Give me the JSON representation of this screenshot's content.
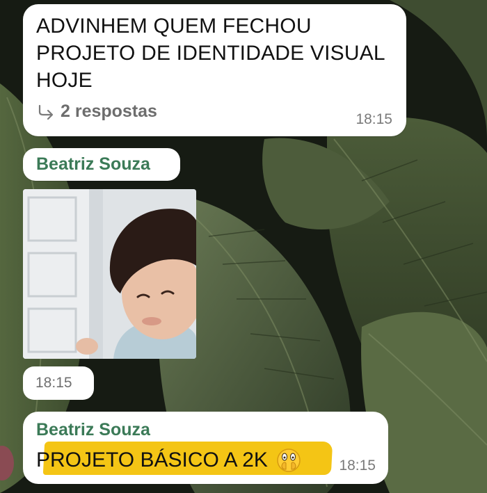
{
  "chat": {
    "message1": {
      "text": "ADVINHEM QUEM FECHOU PROJETO DE IDENTIDADE VISUAL HOJE",
      "replies_label": "2 respostas",
      "reply_icon": "reply-arrow-icon",
      "time": "18:15"
    },
    "sender_name": "Beatriz Souza",
    "photo_message": {
      "image": "photo-of-smiling-child",
      "time": "18:15"
    },
    "message3": {
      "sender": "Beatriz Souza",
      "text": "PROJETO BÁSICO A 2K",
      "emoji": "face-with-open-eyes-and-hand-over-mouth-icon",
      "time": "18:15",
      "highlight_color": "#f4c515"
    }
  },
  "colors": {
    "sender_name": "#3b7a57",
    "bubble": "#ffffff",
    "timestamp": "#7a7a7a"
  }
}
